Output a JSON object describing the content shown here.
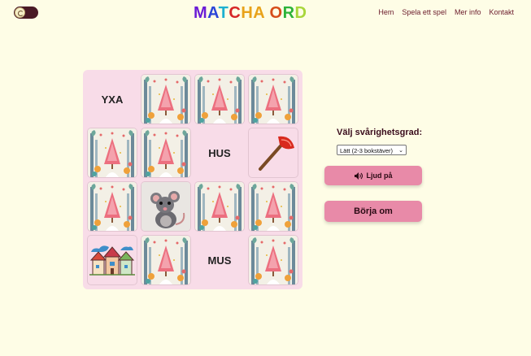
{
  "header": {
    "logo_text": "MATCHA ORD",
    "logo_colors": [
      "#6a1bd6",
      "#2b45d8",
      "#1db0d0",
      "#d62626",
      "#e8a21a",
      "#e8a21a",
      "#d64d1a",
      "#2db33a",
      "#a8d63a"
    ],
    "nav": [
      "Hem",
      "Spela ett spel",
      "Mer info",
      "Kontakt"
    ],
    "theme_toggle_icon": "moon-sun-icon"
  },
  "board": {
    "cells": [
      {
        "type": "word",
        "text": "YXA"
      },
      {
        "type": "back"
      },
      {
        "type": "back"
      },
      {
        "type": "back"
      },
      {
        "type": "back"
      },
      {
        "type": "back"
      },
      {
        "type": "word",
        "text": "HUS"
      },
      {
        "type": "image",
        "icon": "axe-icon"
      },
      {
        "type": "back"
      },
      {
        "type": "image",
        "icon": "mouse-icon"
      },
      {
        "type": "back"
      },
      {
        "type": "back"
      },
      {
        "type": "image",
        "icon": "houses-icon"
      },
      {
        "type": "back"
      },
      {
        "type": "word",
        "text": "MUS"
      },
      {
        "type": "back"
      }
    ]
  },
  "controls": {
    "difficulty_label": "Välj svårighetsgrad:",
    "difficulty_selected": "Lätt (2-3 bokstäver)",
    "sound_label": "Ljud på",
    "sound_icon": "speaker-icon",
    "restart_label": "Börja om"
  }
}
